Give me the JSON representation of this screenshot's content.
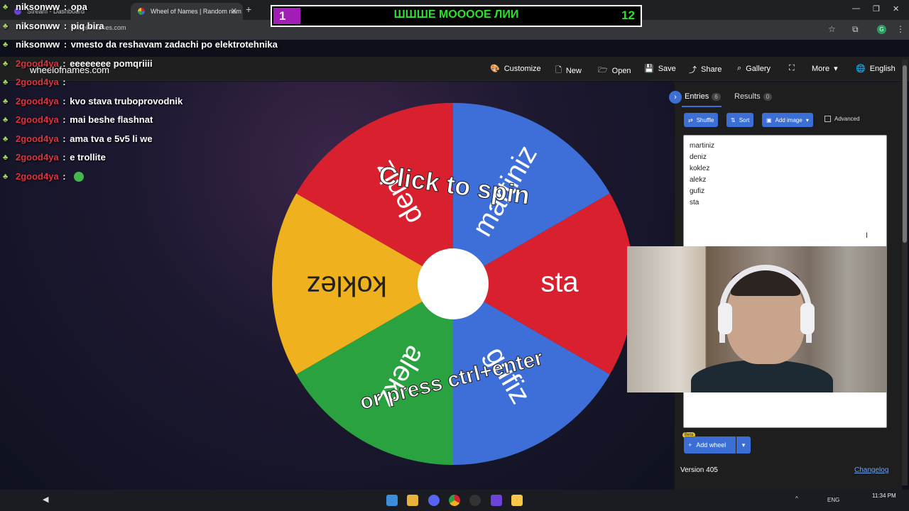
{
  "browser": {
    "tabs": [
      {
        "title": "Stream - Dashboard",
        "active": false
      },
      {
        "title": "Wheel of Names | Random nam",
        "active": true
      }
    ],
    "url": "wheelofnames.com",
    "profile_initial": "G"
  },
  "overlay_banner": {
    "left_score": "1",
    "title": "ШШШЕ МОООOЕ ЛИИ",
    "right_score": "12"
  },
  "chat": [
    {
      "user": "niksonww",
      "text": "opa",
      "user_color": "#ffffff"
    },
    {
      "user": "niksonww",
      "text": "piq bira",
      "user_color": "#ffffff"
    },
    {
      "user": "niksonww",
      "text": "vmesto da reshavam zadachi po elektrotehnika",
      "user_color": "#ffffff"
    },
    {
      "user": "2good4ya",
      "text": "eeeeeeee pomqriiii",
      "user_color": "#e0333a"
    },
    {
      "user": "2good4ya",
      "text": "",
      "user_color": "#e0333a"
    },
    {
      "user": "2good4ya",
      "text": "kvo stava truboprovodnik",
      "user_color": "#e0333a"
    },
    {
      "user": "2good4ya",
      "text": "mai beshe flashnat",
      "user_color": "#e0333a"
    },
    {
      "user": "2good4ya",
      "text": "ama tva e 5v5 li we",
      "user_color": "#e0333a"
    },
    {
      "user": "2good4ya",
      "text": "e trollite",
      "user_color": "#e0333a"
    },
    {
      "user": "2good4ya",
      "text": "",
      "user_color": "#e0333a"
    }
  ],
  "app": {
    "brand": "wheelofnames.com",
    "menu": [
      {
        "label": "Customize",
        "icon": "palette-icon"
      },
      {
        "label": "New",
        "icon": "file-icon"
      },
      {
        "label": "Open",
        "icon": "folder-icon"
      },
      {
        "label": "Save",
        "icon": "save-icon"
      },
      {
        "label": "Share",
        "icon": "share-icon"
      },
      {
        "label": "Gallery",
        "icon": "search-icon"
      },
      {
        "label": "",
        "icon": "fullscreen-icon"
      },
      {
        "label": "More",
        "icon": "chevron-down-icon"
      },
      {
        "label": "English",
        "icon": "globe-icon"
      }
    ]
  },
  "wheel": {
    "spin_hint_top": "Click to spin",
    "spin_hint_bottom": "or press ctrl+enter",
    "segments": [
      {
        "name": "martiniz",
        "color": "#3e6fd8"
      },
      {
        "name": "sta",
        "color": "#d9202f"
      },
      {
        "name": "gufiz",
        "color": "#3e6fd8"
      },
      {
        "name": "alekz",
        "color": "#2aa23f"
      },
      {
        "name": "koklez",
        "color": "#f0b11f"
      },
      {
        "name": "deniz",
        "color": "#d9202f"
      }
    ]
  },
  "panel": {
    "tabs": [
      {
        "label": "Entries",
        "count": "6"
      },
      {
        "label": "Results",
        "count": "0"
      }
    ],
    "buttons": {
      "shuffle": "Shuffle",
      "sort": "Sort",
      "add_image": "Add image",
      "advanced": "Advanced"
    },
    "entries": [
      "martiniz",
      "deniz",
      "koklez",
      "alekz",
      "gufiz",
      "sta"
    ],
    "add_wheel": "Add wheel",
    "beta": "Beta",
    "version": "Version 405",
    "changelog": "Changelog"
  },
  "taskbar": {
    "time": "11:34 PM",
    "lang": "ENG"
  },
  "colors": {
    "accent": "#3b6fd6",
    "banner_green": "#29e229",
    "banner_purple": "#a21cb8"
  }
}
